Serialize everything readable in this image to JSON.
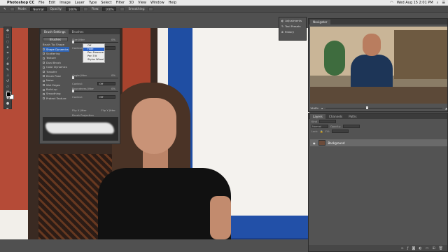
{
  "menubar": {
    "apple_glyph": "",
    "app_name": "Photoshop CC",
    "items": [
      "File",
      "Edit",
      "Image",
      "Layer",
      "Type",
      "Select",
      "Filter",
      "3D",
      "View",
      "Window",
      "Help"
    ],
    "datetime": "Wed Aug 15 2:01 PM"
  },
  "options_bar": {
    "mode_label": "Mode:",
    "mode_value": "Normal",
    "opacity_label": "Opacity:",
    "opacity_value": "100%",
    "flow_label": "Flow:",
    "flow_value": "100%",
    "smoothing_label": "Smoothing:"
  },
  "brush_panel": {
    "tabs": [
      "Brush Settings",
      "Brushes"
    ],
    "brushes_button": "Brushes",
    "items": [
      {
        "label": "Brush Tip Shape",
        "checkbox": false
      },
      {
        "label": "Shape Dynamics",
        "checkbox": true,
        "selected": true
      },
      {
        "label": "Scattering",
        "checkbox": true
      },
      {
        "label": "Texture",
        "checkbox": true
      },
      {
        "label": "Dual Brush",
        "checkbox": true
      },
      {
        "label": "Color Dynamics",
        "checkbox": true
      },
      {
        "label": "Transfer",
        "checkbox": true
      },
      {
        "label": "Brush Pose",
        "checkbox": true
      },
      {
        "label": "Noise",
        "checkbox": true
      },
      {
        "label": "Wet Edges",
        "checkbox": true
      },
      {
        "label": "Build-up",
        "checkbox": true
      },
      {
        "label": "Smoothing",
        "checkbox": true
      },
      {
        "label": "Protect Texture",
        "checkbox": true
      }
    ],
    "size_jitter_label": "Size Jitter",
    "size_jitter_value": "0%",
    "control_label": "Control:",
    "control_value": "Off",
    "angle_jitter_label": "Angle Jitter",
    "angle_jitter_value": "0%",
    "roundness_jitter_label": "Roundness Jitter",
    "roundness_jitter_value": "0%",
    "flip_x_label": "Flip X Jitter",
    "flip_y_label": "Flip Y Jitter",
    "brush_projection_label": "Brush Projection",
    "popup_options": [
      "Off",
      "Fade",
      "Pen Pressure",
      "Pen Tilt",
      "Stylus Wheel"
    ],
    "popup_selected": "Fade"
  },
  "adjustments_panel": {
    "items": [
      {
        "icon": "adjustments-icon",
        "label": "Adjustments"
      },
      {
        "icon": "tool-presets-icon",
        "label": "Tool Presets"
      },
      {
        "icon": "history-icon",
        "label": "History"
      }
    ]
  },
  "navigator_panel": {
    "title": "Navigator",
    "zoom_value": "16.6%"
  },
  "layers_panel": {
    "tabs": [
      "Layers",
      "Channels",
      "Paths"
    ],
    "kind_label": "Kind",
    "blend_mode": "Normal",
    "opacity_label": "Opacity:",
    "lock_label": "Lock:",
    "fill_label": "Fill:",
    "layer_name": "Background",
    "footer_icons": [
      "link-icon",
      "fx-icon",
      "mask-icon",
      "adjustment-icon",
      "folder-icon",
      "new-layer-icon",
      "trash-icon"
    ]
  }
}
